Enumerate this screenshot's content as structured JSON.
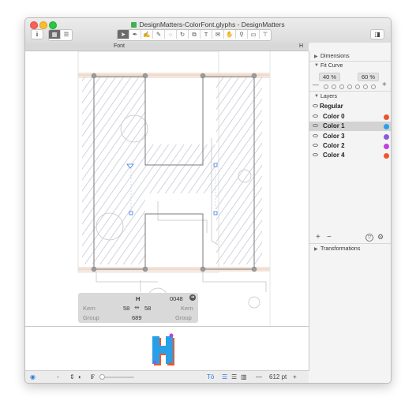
{
  "window": {
    "title": "DesignMatters-ColorFont.glyphs - DesignMatters"
  },
  "toolbar": {
    "info_label": "i",
    "tools": [
      "select-icon",
      "pen-icon",
      "draw-icon",
      "pencil-icon",
      "knife-icon",
      "rotate-icon",
      "scale-icon",
      "text-icon",
      "annotation-icon",
      "hand-icon",
      "zoom-icon",
      "measure-icon",
      "primitives-icon"
    ]
  },
  "tabs": {
    "font": "Font",
    "glyph": "H"
  },
  "glyph_info": {
    "name": "H",
    "unicode": "0048",
    "kern_label": "Kern",
    "lsb": "58",
    "rsb": "58",
    "group_label": "Group",
    "width": "689"
  },
  "status": {
    "dash": "-",
    "zoom": "612 pt",
    "minus": "—",
    "plus": "+"
  },
  "panel": {
    "dimensions": "Dimensions",
    "fit_curve": "Fit Curve",
    "fit_a": "40 %",
    "fit_b": "60 %",
    "layers": "Layers",
    "master": "Regular",
    "items": [
      {
        "name": "Color 0",
        "color": "#e8562a"
      },
      {
        "name": "Color 1",
        "color": "#27a0e8"
      },
      {
        "name": "Color 3",
        "color": "#8a5cdc"
      },
      {
        "name": "Color 2",
        "color": "#c03fe0"
      },
      {
        "name": "Color 4",
        "color": "#f0582b"
      }
    ],
    "plus": "+",
    "minus": "−",
    "transformations": "Transformations"
  },
  "colors": {
    "accent": "#2d7ce5",
    "metric_band": "#f2dccd",
    "hatch": "#cbcfd7"
  }
}
